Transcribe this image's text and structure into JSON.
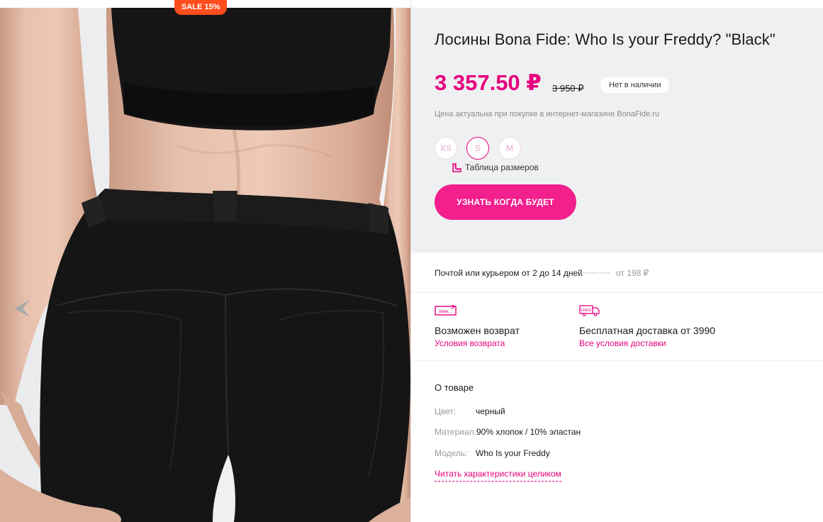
{
  "gallery": {
    "sale_badge": "SALE 15%",
    "prev_icon": "chevron-left-icon"
  },
  "product": {
    "title": "Лосины Bona Fide: Who Is your Freddy? \"Black\"",
    "price": "3 357.50 ₽",
    "old_price": "3 950 ₽",
    "stock_status": "Нет в наличии",
    "price_note": "Цена актуальна при покупке в интернет-магазине BonaFide.ru",
    "sizes": [
      "XS",
      "S",
      "M"
    ],
    "selected_size": "S",
    "size_table_label": "Таблица размеров",
    "notify_button": "УЗНАТЬ КОГДА БУДЕТ"
  },
  "delivery": {
    "text": "Почтой или курьером от 2 до 14 дней",
    "price": "от 198 ₽"
  },
  "benefits": [
    {
      "icon": "return-icon",
      "icon_text": "Хмм...",
      "title": "Возможен возврат",
      "link": "Условия возврата"
    },
    {
      "icon": "free-delivery-truck-icon",
      "icon_text": "FREE",
      "title": "Бесплатная доставка от 3990",
      "link": "Все условия доставки"
    }
  ],
  "about": {
    "title": "О товаре",
    "attributes": [
      {
        "key": "Цвет:",
        "value": "черный"
      },
      {
        "key": "Материал:",
        "value": "90% хлопок / 10% эластан"
      },
      {
        "key": "Модель:",
        "value": "Who Is your Freddy"
      }
    ],
    "read_more": "Читать характеристики целиком"
  },
  "colors": {
    "accent": "#e6007e",
    "button": "#f21f8c",
    "sale_badge": "#ff4d1d",
    "panel_bg": "#eff0f1"
  }
}
